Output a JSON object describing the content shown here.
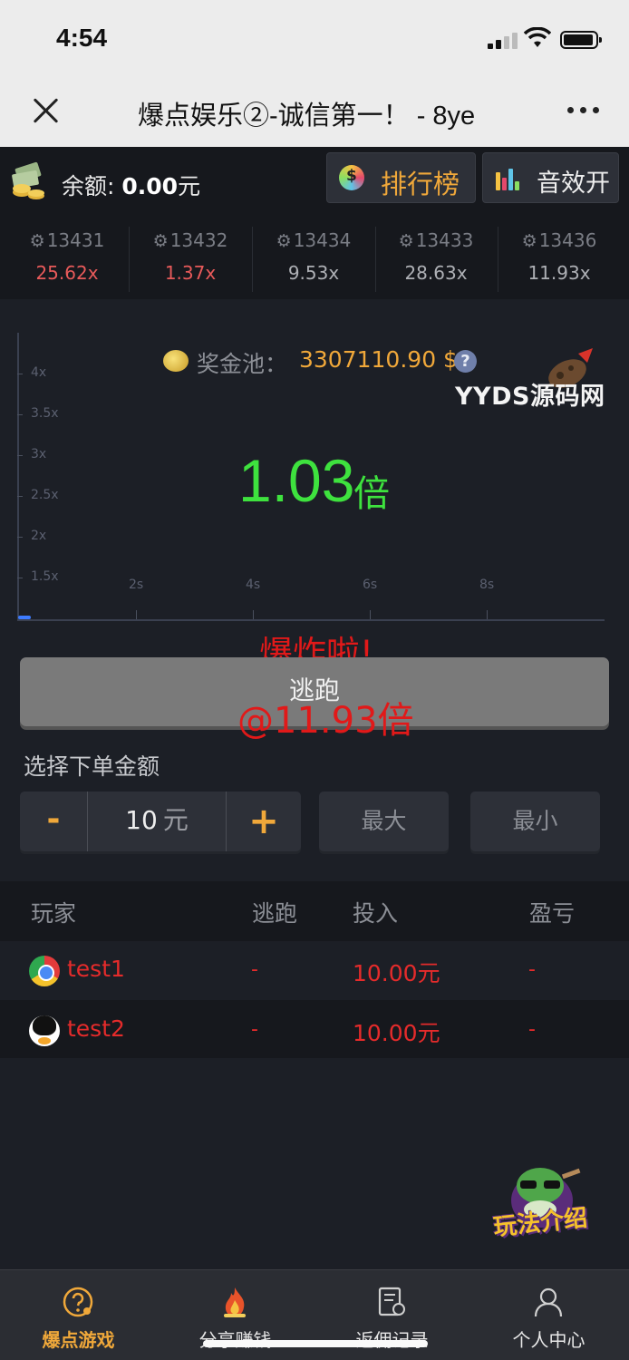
{
  "status_bar": {
    "time": "4:54"
  },
  "nav": {
    "title": "爆点娱乐②-诚信第一！ - 8ye"
  },
  "header": {
    "balance_label": "余额:",
    "balance_value": "0.00",
    "balance_unit": "元",
    "rank_label": "排行榜",
    "sound_label": "音效开"
  },
  "history": [
    {
      "id": "13431",
      "multiplier": "25.62x",
      "color": "#e85a5a"
    },
    {
      "id": "13432",
      "multiplier": "1.37x",
      "color": "#e85a5a"
    },
    {
      "id": "13434",
      "multiplier": "9.53x",
      "color": "#aeb0b5"
    },
    {
      "id": "13433",
      "multiplier": "28.63x",
      "color": "#aeb0b5"
    },
    {
      "id": "13436",
      "multiplier": "11.93x",
      "color": "#aeb0b5"
    }
  ],
  "game": {
    "pool_label": "奖金池：",
    "pool_value": "3307110.90 $",
    "watermark": "YYDS源码网",
    "multiplier_value": "1.03",
    "multiplier_unit": "倍",
    "boom_text": "爆炸啦!",
    "cashout_text": "@11.93倍",
    "y_ticks": [
      "4x",
      "3.5x",
      "3x",
      "2.5x",
      "2x",
      "1.5x"
    ],
    "x_ticks": [
      "2s",
      "4s",
      "6s",
      "8s"
    ]
  },
  "escape_label": "逃跑",
  "bet": {
    "label": "选择下单金额",
    "minus": "-",
    "amount": "10",
    "unit": "元",
    "plus": "+",
    "max_label": "最大",
    "min_label": "最小"
  },
  "table": {
    "headers": [
      "玩家",
      "逃跑",
      "投入",
      "盈亏"
    ],
    "rows": [
      {
        "player": "test1",
        "escape": "-",
        "bet": "10.00元",
        "profit": "-"
      },
      {
        "player": "test2",
        "escape": "-",
        "bet": "10.00元",
        "profit": "-"
      }
    ]
  },
  "mascot_label": "玩法介绍",
  "tabs": [
    {
      "label": "爆点游戏"
    },
    {
      "label": "分享赚钱"
    },
    {
      "label": "返佣记录"
    },
    {
      "label": "个人中心"
    }
  ],
  "colors": {
    "accent": "#f0a83a",
    "multiplier": "#3ee23e",
    "danger": "#e11919"
  }
}
